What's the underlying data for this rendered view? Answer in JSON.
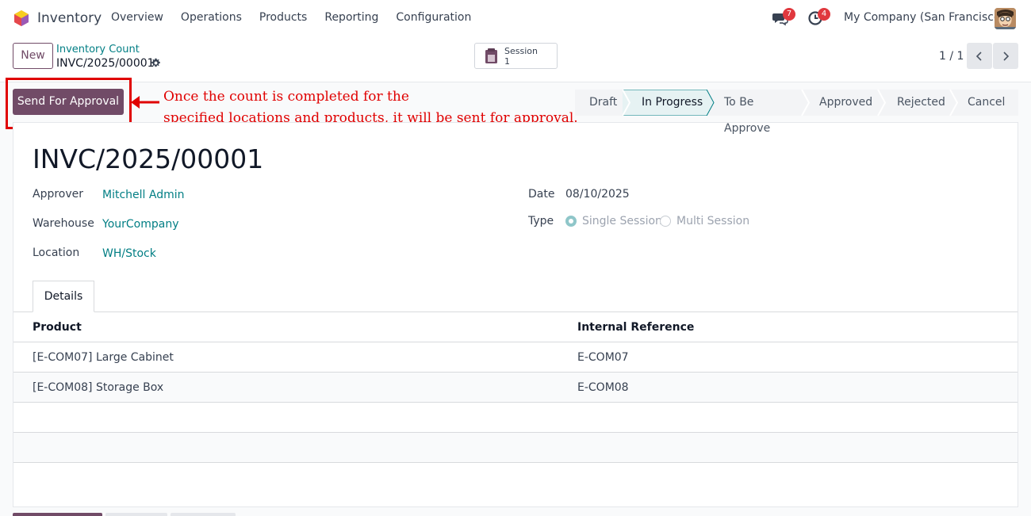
{
  "app": {
    "name": "Inventory",
    "menu": [
      "Overview",
      "Operations",
      "Products",
      "Reporting",
      "Configuration"
    ],
    "chat_badge": "7",
    "activity_badge": "4",
    "company": "My Company (San Francisco)"
  },
  "control": {
    "new_label": "New",
    "breadcrumb_parent": "Inventory Count",
    "breadcrumb_current": "INVC/2025/00001",
    "session_label": "Session",
    "session_count": "1",
    "pager": "1 / 1"
  },
  "actions": {
    "send_label": "Send For Approval",
    "annotation_line1": "Once the count is completed for the",
    "annotation_line2": "specified locations and products, it will be sent for approval."
  },
  "status": {
    "stages": [
      "Draft",
      "In Progress",
      "To Be Approve",
      "Approved",
      "Rejected",
      "Cancel"
    ],
    "active": "In Progress"
  },
  "form": {
    "title": "INVC/2025/00001",
    "approver_label": "Approver",
    "approver": "Mitchell Admin",
    "warehouse_label": "Warehouse",
    "warehouse": "YourCompany",
    "location_label": "Location",
    "location": "WH/Stock",
    "date_label": "Date",
    "date": "08/10/2025",
    "type_label": "Type",
    "type_options": [
      "Single Session",
      "Multi Session"
    ],
    "type_selected": "Single Session"
  },
  "details": {
    "tab_label": "Details",
    "columns": [
      "Product",
      "Internal Reference"
    ],
    "rows": [
      [
        "[E-COM07] Large Cabinet",
        "E-COM07"
      ],
      [
        "[E-COM08] Storage Box",
        "E-COM08"
      ]
    ]
  },
  "colors": {
    "brand": "#714b67",
    "link": "#017e84",
    "annotation": "#e00000",
    "badge": "#e0383e"
  }
}
